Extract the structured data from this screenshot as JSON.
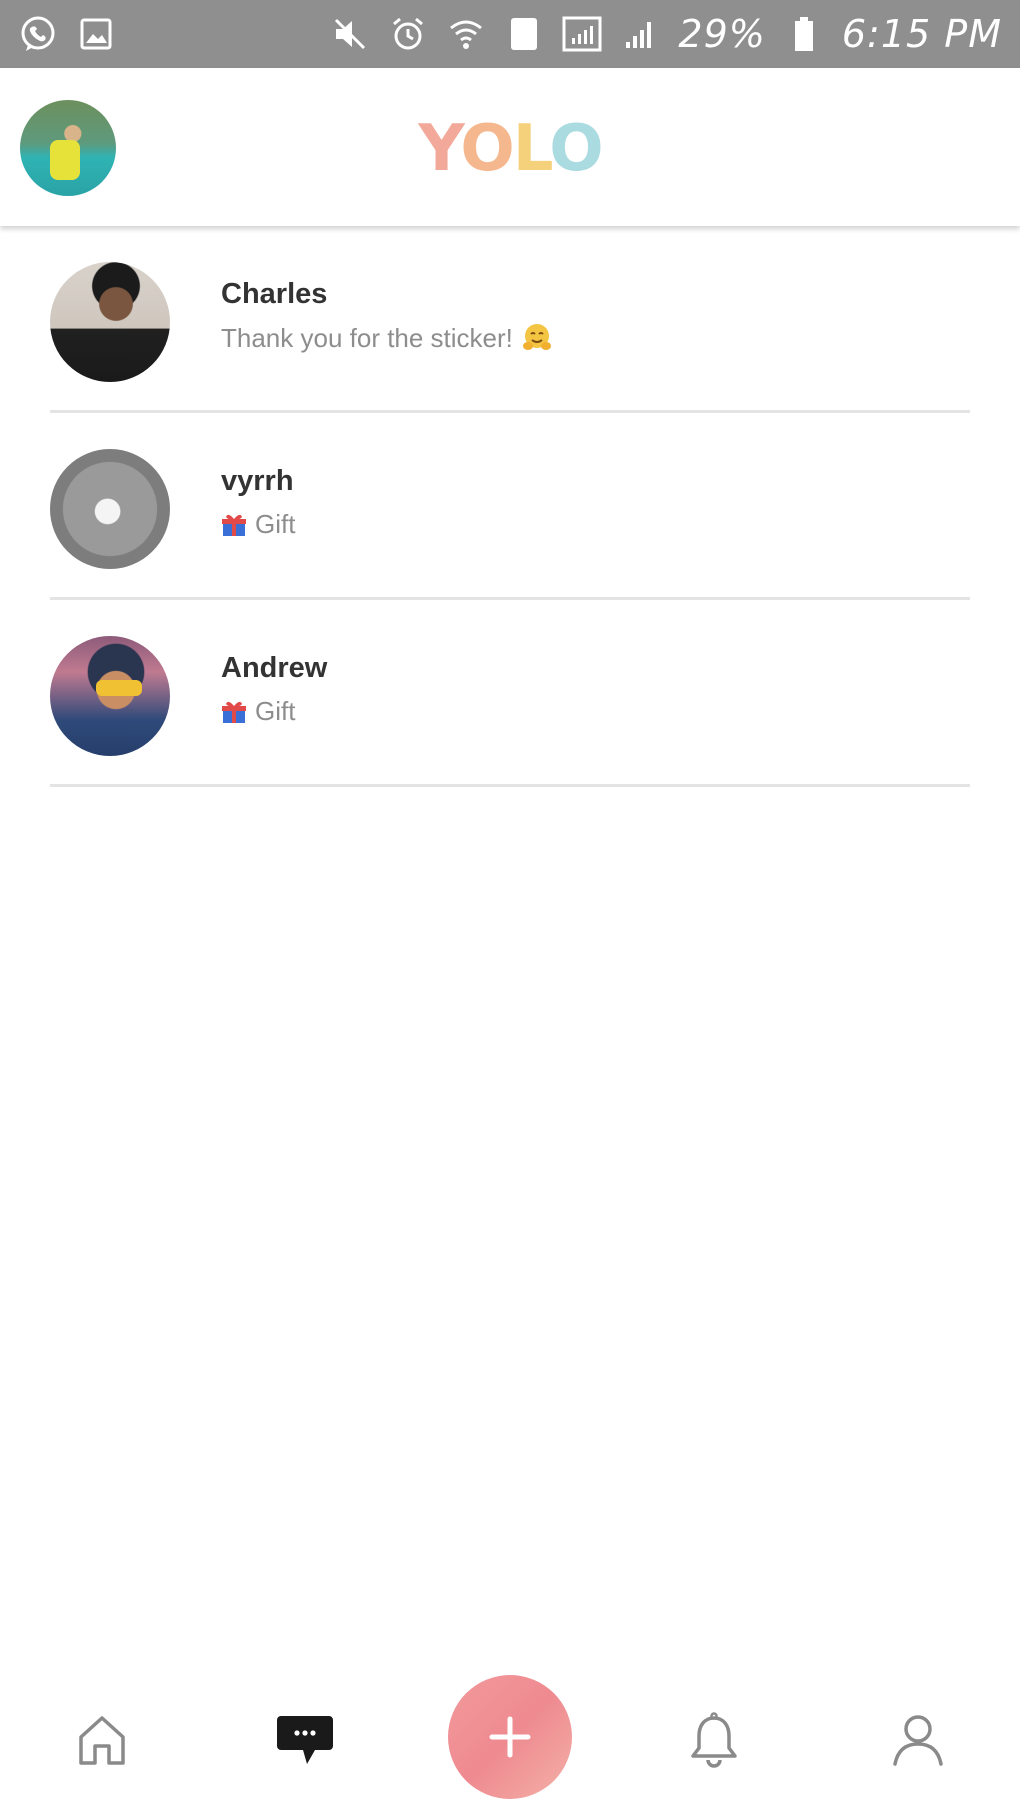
{
  "status_bar": {
    "battery": "29%",
    "time": "6:15 PM",
    "sim_slot": "1",
    "icons_left": [
      "viber-icon",
      "gallery-icon"
    ],
    "icons_right": [
      "mute-icon",
      "alarm-icon",
      "wifi-icon",
      "sim-icon",
      "signal-icon",
      "signal-icon",
      "battery-icon"
    ]
  },
  "header": {
    "logo": {
      "y": "Y",
      "o1": "O",
      "l": "L",
      "o2": "O"
    },
    "logo_colors": [
      "#f2a99a",
      "#f5b78d",
      "#f6d17c",
      "#a9dbe0"
    ]
  },
  "conversations": [
    {
      "name": "Charles",
      "preview": "Thank you for the sticker!",
      "preview_icon": "hugging-face-emoji-icon"
    },
    {
      "name": "vyrrh",
      "preview": "Gift",
      "preview_icon": "gift-icon"
    },
    {
      "name": "Andrew",
      "preview": "Gift",
      "preview_icon": "gift-icon"
    }
  ],
  "bottom_nav": {
    "items": [
      "home-icon",
      "messages-icon",
      "add-icon",
      "notifications-icon",
      "profile-icon"
    ],
    "active": "messages-icon",
    "fab_color": "#ee8a90"
  }
}
